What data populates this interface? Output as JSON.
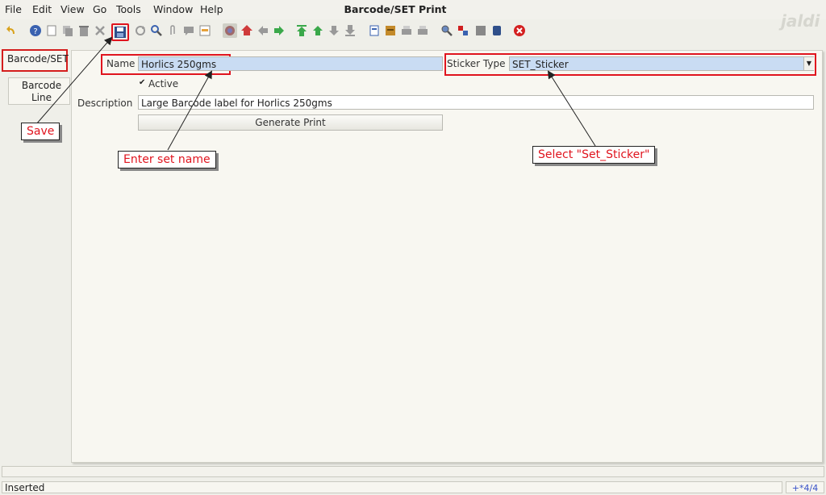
{
  "menubar": {
    "items": [
      {
        "label": "File"
      },
      {
        "label": "Edit"
      },
      {
        "label": "View"
      },
      {
        "label": "Go"
      },
      {
        "label": "Tools"
      },
      {
        "label": "Window"
      },
      {
        "label": "Help"
      }
    ],
    "title": "Barcode/SET Print",
    "logo_text": "jaldi"
  },
  "toolbar": {
    "icons": [
      "undo-icon",
      "help-icon",
      "new-icon",
      "copy-icon",
      "delete-icon",
      "delete-selection-icon",
      "save-icon",
      "refresh-icon",
      "find-icon",
      "attachment-icon",
      "chat-icon",
      "history-icon",
      "home-icon",
      "parent-icon",
      "previous-icon",
      "next-icon",
      "first-icon",
      "up-icon",
      "down-icon",
      "last-icon",
      "report-icon",
      "archive-icon",
      "print-icon",
      "print-preview-icon",
      "zoom-icon",
      "process-icon",
      "product-info-icon",
      "workflow-icon",
      "close-window-icon"
    ]
  },
  "tabs": {
    "items": [
      {
        "label": "Barcode/SET"
      },
      {
        "label": "Barcode Line"
      }
    ]
  },
  "form": {
    "name_label": "Name",
    "name_value": "Horlics 250gms",
    "sticker_type_label": "Sticker Type",
    "sticker_type_value": "SET_Sticker",
    "active_label": "Active",
    "active_checked": true,
    "description_label": "Description",
    "description_value": "Large Barcode label for Horlics 250gms",
    "generate_button": "Generate Print"
  },
  "callouts": {
    "save": "Save",
    "enter_set_name": "Enter set name",
    "select_sticker": "Select \"Set_Sticker\""
  },
  "colors": {
    "annotation_red": "#e0141e",
    "field_highlight": "#c9dcf3"
  },
  "status": {
    "text": "Inserted",
    "record": "+*4/4"
  }
}
